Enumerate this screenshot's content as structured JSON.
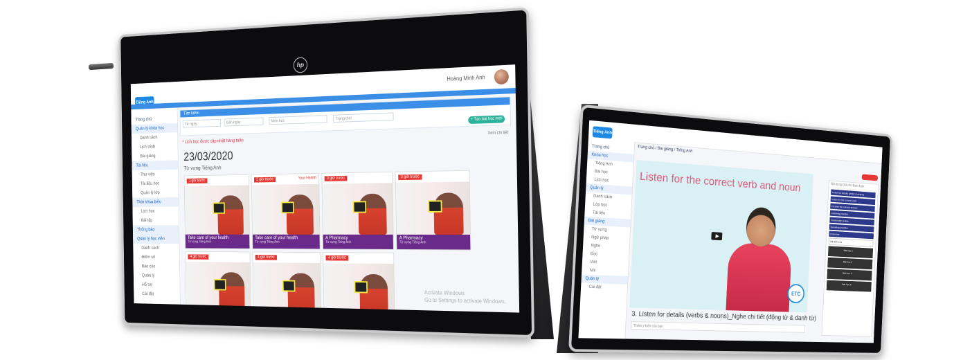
{
  "brand": {
    "logo_text": "Tiếng Anh",
    "device_logo": "hp"
  },
  "left": {
    "user_name": "Hoàng Minh Anh",
    "sidebar_items": [
      {
        "label": "Trang chủ",
        "active": false,
        "sub": false
      },
      {
        "label": "Quản lý khóa học",
        "active": true,
        "sub": false
      },
      {
        "label": "Danh sách",
        "active": false,
        "sub": true
      },
      {
        "label": "Lịch trình",
        "active": false,
        "sub": true
      },
      {
        "label": "Bài giảng",
        "active": false,
        "sub": true
      },
      {
        "label": "Tài liệu",
        "active": true,
        "sub": false
      },
      {
        "label": "Thư viện",
        "active": false,
        "sub": true
      },
      {
        "label": "Tài liệu học",
        "active": false,
        "sub": true
      },
      {
        "label": "Quản lý lớp",
        "active": false,
        "sub": true
      },
      {
        "label": "Thời khóa biểu",
        "active": true,
        "sub": false
      },
      {
        "label": "Lịch học",
        "active": false,
        "sub": true
      },
      {
        "label": "Bài tập",
        "active": false,
        "sub": true
      },
      {
        "label": "Thông báo",
        "active": true,
        "sub": false
      },
      {
        "label": "Quản lý học viên",
        "active": true,
        "sub": false
      },
      {
        "label": "Danh sách",
        "active": false,
        "sub": true
      },
      {
        "label": "Điểm số",
        "active": false,
        "sub": true
      },
      {
        "label": "Báo cáo",
        "active": false,
        "sub": true
      },
      {
        "label": "Quản lý",
        "active": false,
        "sub": true
      },
      {
        "label": "Hỗ trợ",
        "active": false,
        "sub": true
      },
      {
        "label": "Cài đặt",
        "active": false,
        "sub": true
      }
    ],
    "filter": {
      "header": "Tìm kiếm",
      "fields": [
        "Từ ngày",
        "Đến ngày",
        "Môn học",
        "Trạng thái"
      ],
      "create_button": "+ Tạo bài học mới"
    },
    "notice": "* Lịch học được cập nhật hàng tuần",
    "notice_right": "Xem chi tiết",
    "date": "23/03/2020",
    "date_subtitle": "Từ vựng Tiếng Anh",
    "cards": [
      {
        "tag": "1 giờ trước",
        "header": "",
        "title": "Take care of your health",
        "meta": "Từ vựng Tiếng Anh",
        "dark": true
      },
      {
        "tag": "2 giờ trước",
        "header": "Your Health",
        "title": "Take care of your health",
        "meta": "Từ vựng Tiếng Anh",
        "dark": true
      },
      {
        "tag": "3 giờ trước",
        "header": "",
        "title": "A Pharmacy",
        "meta": "Từ vựng Tiếng Anh",
        "dark": true
      },
      {
        "tag": "3 giờ trước",
        "header": "",
        "title": "A Pharmacy",
        "meta": "Từ vựng Tiếng Anh",
        "dark": true
      },
      {
        "tag": "4 giờ trước",
        "header": "",
        "title": "",
        "meta": "",
        "dark": false
      },
      {
        "tag": "4 giờ trước",
        "header": "",
        "title": "",
        "meta": "",
        "dark": false
      },
      {
        "tag": "4 giờ trước",
        "header": "",
        "title": "",
        "meta": "",
        "dark": false
      }
    ],
    "watermark_line1": "Activate Windows",
    "watermark_line2": "Go to Settings to activate Windows."
  },
  "right": {
    "breadcrumb": "Trang chủ / Bài giảng / Tiếng Anh",
    "sidebar_items": [
      {
        "label": "Trang chủ",
        "active": false,
        "sub": false
      },
      {
        "label": "Khóa học",
        "active": true,
        "sub": false
      },
      {
        "label": "Tiếng Anh",
        "active": false,
        "sub": true
      },
      {
        "label": "Bài học",
        "active": false,
        "sub": true
      },
      {
        "label": "Lịch học",
        "active": false,
        "sub": true
      },
      {
        "label": "Quản lý",
        "active": true,
        "sub": false
      },
      {
        "label": "Danh sách",
        "active": false,
        "sub": true
      },
      {
        "label": "Lớp học",
        "active": false,
        "sub": true
      },
      {
        "label": "Tài liệu",
        "active": false,
        "sub": true
      },
      {
        "label": "Bài giảng",
        "active": true,
        "sub": false
      },
      {
        "label": "Từ vựng",
        "active": false,
        "sub": true
      },
      {
        "label": "Ngữ pháp",
        "active": false,
        "sub": true
      },
      {
        "label": "Nghe",
        "active": false,
        "sub": true
      },
      {
        "label": "Đọc",
        "active": false,
        "sub": true
      },
      {
        "label": "Viết",
        "active": false,
        "sub": true
      },
      {
        "label": "Nói",
        "active": false,
        "sub": true
      },
      {
        "label": "Quản lý",
        "active": true,
        "sub": false
      },
      {
        "label": "Cài đặt",
        "active": false,
        "sub": true
      }
    ],
    "video_title": "Listen for the correct verb and noun",
    "video_logo": "ETC",
    "lesson_title": "3. Listen for details (verbs & nouns)_Nghe chi tiết (động từ & danh từ)",
    "comment_placeholder": "Thêm ý kiến của bạn",
    "panel_tabs": "Nội dung   Ghi chú   Bình luận",
    "panel_items": [
      {
        "label": "Listen for details (verbs & nouns)",
        "alt": false
      },
      {
        "label": "Listen for the correct verb",
        "alt": false
      },
      {
        "label": "Choose the correct answer",
        "alt": false
      },
      {
        "label": "Listening practice",
        "alt": false
      },
      {
        "label": "Vocabulary review",
        "alt": false
      },
      {
        "label": "Speaking practice",
        "alt": false
      },
      {
        "label": "Grammar",
        "alt": false
      },
      {
        "label": "Bài kiểm tra",
        "alt": true
      }
    ],
    "panel_videos": [
      "Bài học 1",
      "Bài học 2",
      "Bài học 3",
      "Bài học 4"
    ]
  }
}
